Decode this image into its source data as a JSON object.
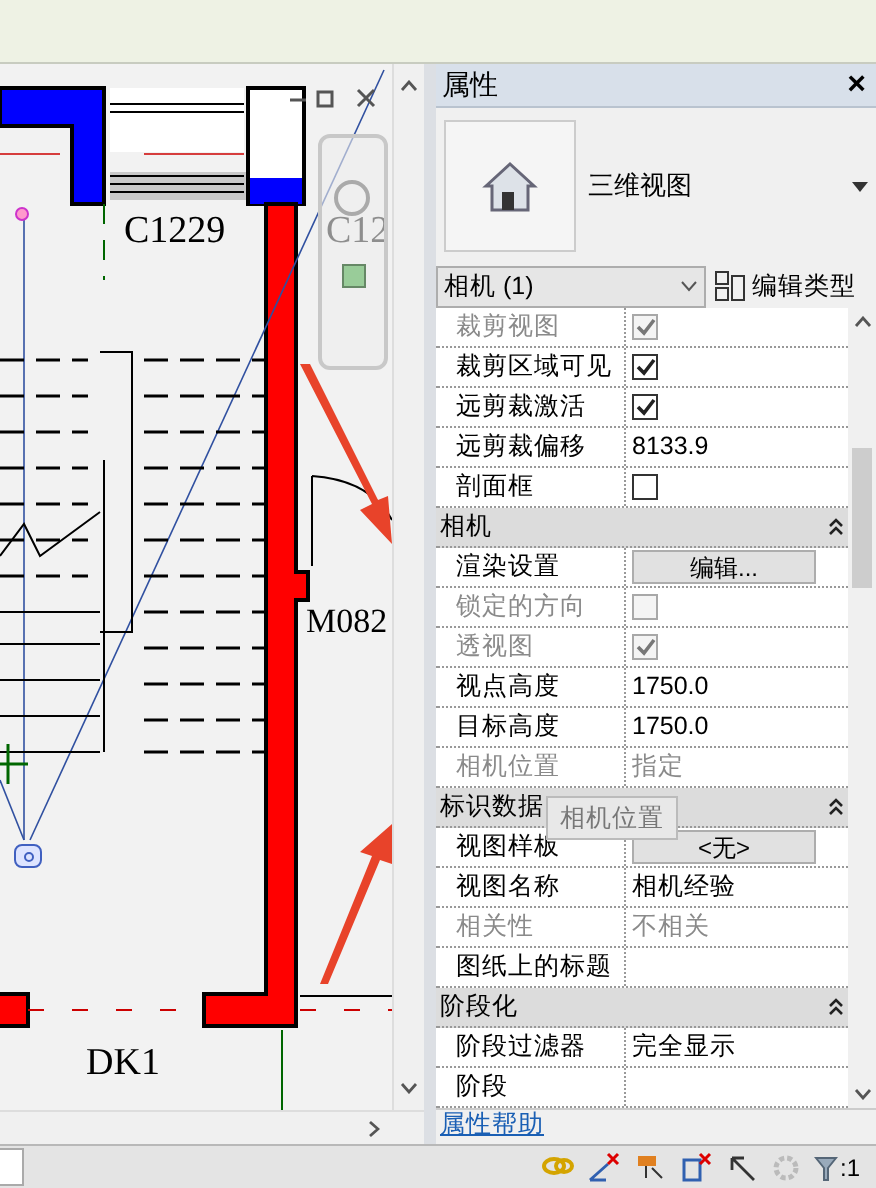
{
  "drawing": {
    "labels": [
      {
        "text": "C1229"
      },
      {
        "text": "C12"
      },
      {
        "text": "M082"
      },
      {
        "text": "DK1"
      }
    ],
    "tooltip": "相机位置"
  },
  "properties": {
    "title": "属性",
    "close": "×",
    "type_name": "三维视图",
    "instance_filter": "相机 (1)",
    "edit_type": "编辑类型",
    "rows": [
      {
        "kind": "check",
        "label": "裁剪视图",
        "checked": true,
        "disabled": true
      },
      {
        "kind": "check",
        "label": "裁剪区域可见",
        "checked": true,
        "disabled": false
      },
      {
        "kind": "check",
        "label": "远剪裁激活",
        "checked": true,
        "disabled": false
      },
      {
        "kind": "text",
        "label": "远剪裁偏移",
        "value": "8133.9",
        "disabled": false
      },
      {
        "kind": "check",
        "label": "剖面框",
        "checked": false,
        "disabled": false
      },
      {
        "kind": "header",
        "label": "相机",
        "expanded": true
      },
      {
        "kind": "button",
        "label": "渲染设置",
        "value": "编辑...",
        "disabled": false
      },
      {
        "kind": "check",
        "label": "锁定的方向",
        "checked": false,
        "disabled": true
      },
      {
        "kind": "check",
        "label": "透视图",
        "checked": true,
        "disabled": true
      },
      {
        "kind": "text",
        "label": "视点高度",
        "value": "1750.0",
        "disabled": false
      },
      {
        "kind": "text",
        "label": "目标高度",
        "value": "1750.0",
        "disabled": false
      },
      {
        "kind": "text",
        "label": "相机位置",
        "value": "指定",
        "disabled": true
      },
      {
        "kind": "header",
        "label": "标识数据",
        "expanded": true
      },
      {
        "kind": "button",
        "label": "视图样板",
        "value": "<无>",
        "disabled": false
      },
      {
        "kind": "text",
        "label": "视图名称",
        "value": "相机经验",
        "disabled": false
      },
      {
        "kind": "text",
        "label": "相关性",
        "value": "不相关",
        "disabled": true
      },
      {
        "kind": "text",
        "label": "图纸上的标题",
        "disabled": false
      },
      {
        "kind": "header",
        "label": "阶段化",
        "expanded": true
      },
      {
        "kind": "text",
        "label": "阶段过滤器",
        "value": "完全显示",
        "disabled": false
      },
      {
        "kind": "text",
        "label": "阶段",
        "disabled": false
      }
    ],
    "help_link": "属性帮助"
  },
  "status_bar": {
    "filter_count": ":1"
  }
}
